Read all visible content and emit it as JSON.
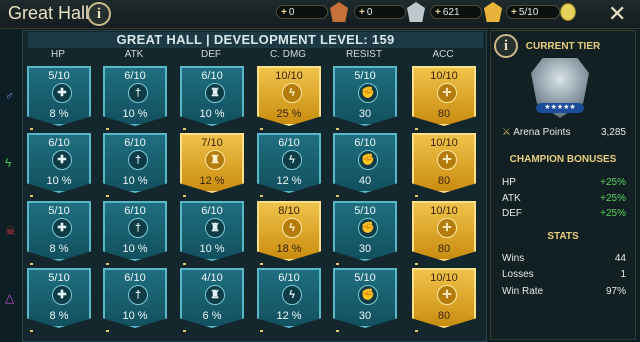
{
  "header": {
    "title": "Great Hall",
    "info_icon": "i",
    "close_icon": "✕",
    "resources": [
      {
        "plus": "+",
        "value": "0",
        "icon": "bronze-medal-icon",
        "color": "#c8703a"
      },
      {
        "plus": "+",
        "value": "0",
        "icon": "silver-medal-icon",
        "color": "#bfc7cc"
      },
      {
        "plus": "+",
        "value": "621",
        "icon": "gold-medal-icon",
        "color": "#e7b33a"
      },
      {
        "plus": "+",
        "value": "5/10",
        "icon": "coin-icon",
        "color": "#e8d15a"
      }
    ]
  },
  "board": {
    "banner": "GREAT HALL | DEVELOPMENT LEVEL: 159",
    "columns": [
      "HP",
      "ATK",
      "DEF",
      "C. DMG",
      "RESIST",
      "ACC"
    ],
    "rows": [
      {
        "affinity": "magic-icon",
        "color": "#6f8cf0",
        "cells": [
          {
            "level": "5/10",
            "value": "8 %",
            "gold": false,
            "icon": "✚"
          },
          {
            "level": "6/10",
            "value": "10 %",
            "gold": false,
            "icon": "†"
          },
          {
            "level": "6/10",
            "value": "10 %",
            "gold": false,
            "icon": "♜"
          },
          {
            "level": "10/10",
            "value": "25 %",
            "gold": true,
            "icon": "ϟ"
          },
          {
            "level": "5/10",
            "value": "30",
            "gold": false,
            "icon": "✊"
          },
          {
            "level": "10/10",
            "value": "80",
            "gold": true,
            "icon": "✛"
          }
        ]
      },
      {
        "affinity": "force-icon",
        "color": "#48c757",
        "cells": [
          {
            "level": "6/10",
            "value": "10 %",
            "gold": false,
            "icon": "✚"
          },
          {
            "level": "6/10",
            "value": "10 %",
            "gold": false,
            "icon": "†"
          },
          {
            "level": "7/10",
            "value": "12 %",
            "gold": true,
            "icon": "♜"
          },
          {
            "level": "6/10",
            "value": "12 %",
            "gold": false,
            "icon": "ϟ"
          },
          {
            "level": "6/10",
            "value": "40",
            "gold": false,
            "icon": "✊"
          },
          {
            "level": "10/10",
            "value": "80",
            "gold": true,
            "icon": "✛"
          }
        ]
      },
      {
        "affinity": "void-icon",
        "color": "#d23a3a",
        "cells": [
          {
            "level": "5/10",
            "value": "8 %",
            "gold": false,
            "icon": "✚"
          },
          {
            "level": "6/10",
            "value": "10 %",
            "gold": false,
            "icon": "†"
          },
          {
            "level": "6/10",
            "value": "10 %",
            "gold": false,
            "icon": "♜"
          },
          {
            "level": "8/10",
            "value": "18 %",
            "gold": true,
            "icon": "ϟ"
          },
          {
            "level": "5/10",
            "value": "30",
            "gold": false,
            "icon": "✊"
          },
          {
            "level": "10/10",
            "value": "80",
            "gold": true,
            "icon": "✛"
          }
        ]
      },
      {
        "affinity": "spirit-icon",
        "color": "#c254d6",
        "cells": [
          {
            "level": "5/10",
            "value": "8 %",
            "gold": false,
            "icon": "✚"
          },
          {
            "level": "6/10",
            "value": "10 %",
            "gold": false,
            "icon": "†"
          },
          {
            "level": "4/10",
            "value": "6 %",
            "gold": false,
            "icon": "♜"
          },
          {
            "level": "6/10",
            "value": "12 %",
            "gold": false,
            "icon": "ϟ"
          },
          {
            "level": "5/10",
            "value": "30",
            "gold": false,
            "icon": "✊"
          },
          {
            "level": "10/10",
            "value": "80",
            "gold": true,
            "icon": "✛"
          }
        ]
      }
    ]
  },
  "panel": {
    "current_tier_title": "CURRENT TIER",
    "stars": "★★★★★",
    "arena_points_label": "Arena Points",
    "arena_points_value": "3,285",
    "bonuses_title": "CHAMPION BONUSES",
    "bonuses": [
      {
        "label": "HP",
        "value": "+25%"
      },
      {
        "label": "ATK",
        "value": "+25%"
      },
      {
        "label": "DEF",
        "value": "+25%"
      }
    ],
    "stats_title": "STATS",
    "stats": [
      {
        "label": "Wins",
        "value": "44"
      },
      {
        "label": "Losses",
        "value": "1"
      },
      {
        "label": "Win Rate",
        "value": "97%"
      }
    ]
  }
}
